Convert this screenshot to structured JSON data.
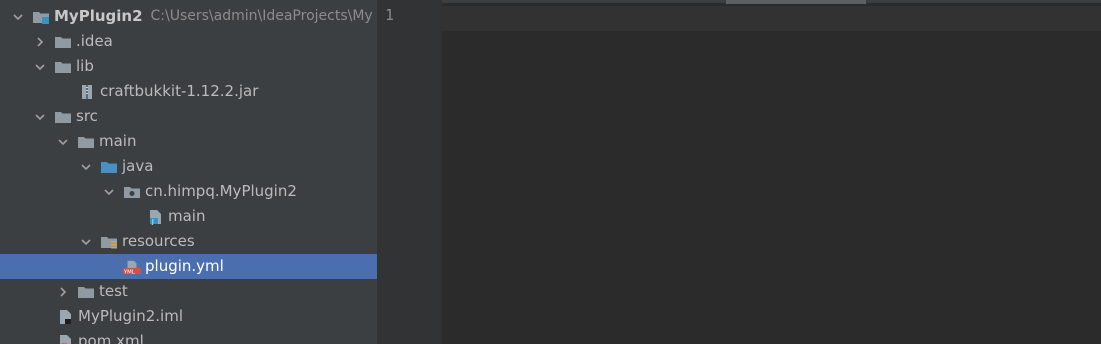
{
  "project_tree": {
    "items": [
      {
        "label": "MyPlugin2",
        "path": "C:\\Users\\admin\\IdeaProjects\\My",
        "icon": "module-folder-icon",
        "expanded": true
      },
      {
        "label": ".idea",
        "icon": "folder-icon",
        "expanded": false
      },
      {
        "label": "lib",
        "icon": "folder-icon",
        "expanded": true
      },
      {
        "label": "craftbukkit-1.12.2.jar",
        "icon": "jar-archive-icon"
      },
      {
        "label": "src",
        "icon": "folder-icon",
        "expanded": true
      },
      {
        "label": "main",
        "icon": "folder-icon",
        "expanded": true
      },
      {
        "label": "java",
        "icon": "source-root-folder-icon",
        "expanded": true
      },
      {
        "label": "cn.himpq.MyPlugin2",
        "icon": "package-icon",
        "expanded": true
      },
      {
        "label": "main",
        "icon": "java-file-icon"
      },
      {
        "label": "resources",
        "icon": "resources-folder-icon",
        "expanded": true
      },
      {
        "label": "plugin.yml",
        "icon": "yml-file-icon",
        "selected": true
      },
      {
        "label": "test",
        "icon": "folder-icon",
        "expanded": false
      },
      {
        "label": "MyPlugin2.iml",
        "icon": "iml-file-icon"
      },
      {
        "label": "pom.xml",
        "icon": "maven-file-icon"
      }
    ]
  },
  "editor": {
    "line_number": "1"
  },
  "colors": {
    "panel_bg": "#3c3f41",
    "selection": "#4b6eaf",
    "editor_bg": "#2b2b2b",
    "gutter_bg": "#313335",
    "folder": "#8f9aa3",
    "source_folder": "#4a8fc4"
  }
}
